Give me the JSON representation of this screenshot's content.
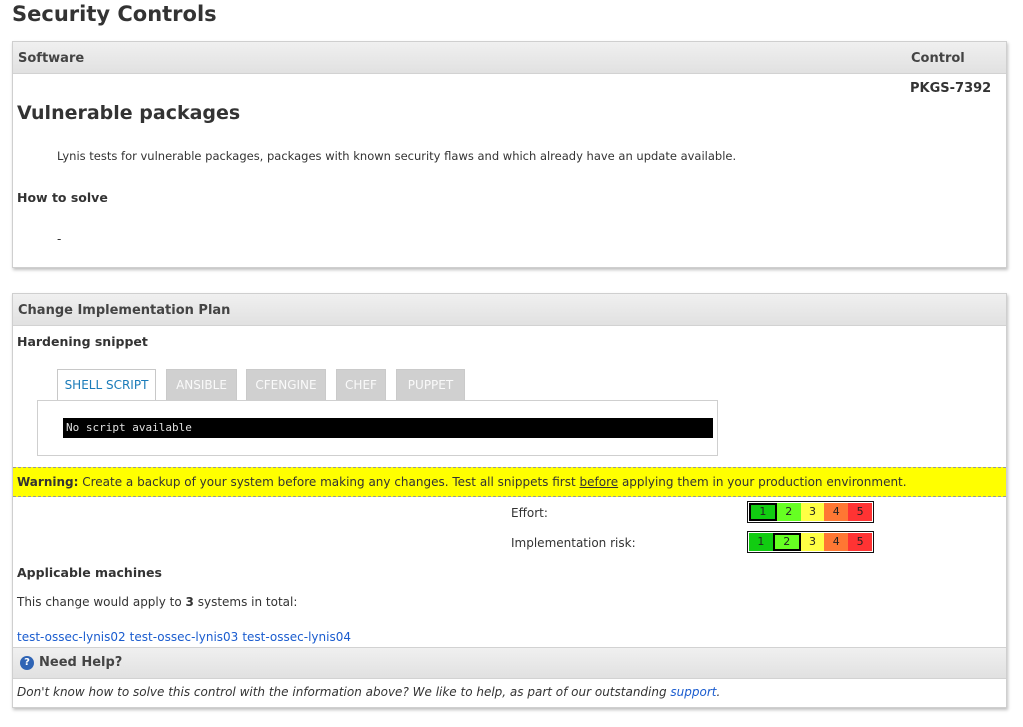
{
  "page": {
    "title": "Security Controls"
  },
  "control_table": {
    "col_software": "Software",
    "col_control": "Control",
    "control_id": "PKGS-7392",
    "heading": "Vulnerable packages",
    "description": "Lynis tests for vulnerable packages, packages with known security flaws and which already have an update available.",
    "how_to_solve_label": "How to solve",
    "how_to_solve_value": "-"
  },
  "plan": {
    "header": "Change Implementation Plan",
    "snippet_label": "Hardening snippet",
    "tabs": [
      {
        "label": "SHELL SCRIPT",
        "active": true
      },
      {
        "label": "ANSIBLE",
        "active": false
      },
      {
        "label": "CFENGINE",
        "active": false
      },
      {
        "label": "CHEF",
        "active": false
      },
      {
        "label": "PUPPET",
        "active": false
      }
    ],
    "code": "No script available",
    "warning": {
      "label": "Warning:",
      "text_before": " Create a backup of your system before making any changes. Test all snippets first ",
      "underlined": "before",
      "text_after": " applying them in your production environment."
    },
    "effort": {
      "label": "Effort:",
      "selected": 1,
      "scale": [
        "1",
        "2",
        "3",
        "4",
        "5"
      ]
    },
    "risk": {
      "label": "Implementation risk:",
      "selected": 2,
      "scale": [
        "1",
        "2",
        "3",
        "4",
        "5"
      ]
    },
    "score_colors": [
      "#11cc11",
      "#66ff22",
      "#ffff44",
      "#ff7733",
      "#ff3333"
    ],
    "applicable_label": "Applicable machines",
    "apply_prefix": "This change would apply to ",
    "apply_count": "3",
    "apply_suffix": " systems in total:",
    "machines": [
      "test-ossec-lynis02",
      "test-ossec-lynis03",
      "test-ossec-lynis04"
    ]
  },
  "help": {
    "title": "Need Help?",
    "icon": "question-icon",
    "text": "Don't know how to solve this control with the information above? We like to help, as part of our outstanding ",
    "link": "support",
    "end": "."
  }
}
